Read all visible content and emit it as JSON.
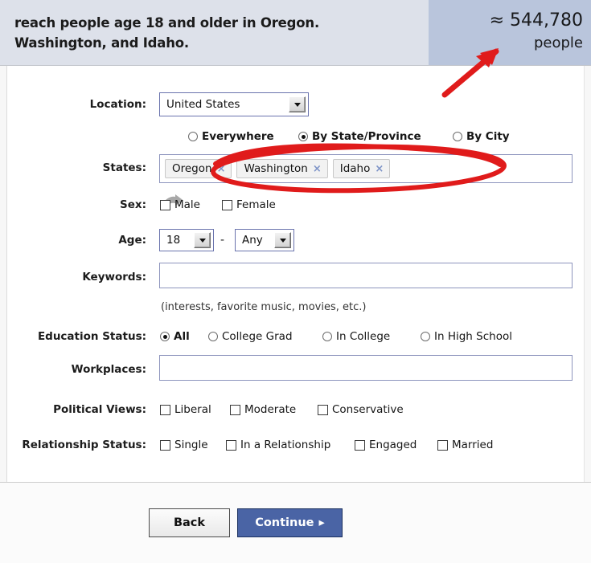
{
  "header": {
    "headline_line1": "reach people age 18 and older in Oregon.",
    "headline_line2": "Washington, and Idaho.",
    "reach_count": "≈ 544,780",
    "reach_label": "people"
  },
  "form": {
    "location": {
      "label": "Location:",
      "selected": "United States",
      "scope_options": [
        {
          "label": "Everywhere",
          "selected": false
        },
        {
          "label": "By State/Province",
          "selected": true
        },
        {
          "label": "By City",
          "selected": false
        }
      ]
    },
    "states": {
      "label": "States:",
      "tokens": [
        "Oregon",
        "Washington",
        "Idaho"
      ],
      "remove_glyph": "×"
    },
    "sex": {
      "label": "Sex:",
      "options": [
        {
          "label": "Male",
          "checked": false
        },
        {
          "label": "Female",
          "checked": false
        }
      ]
    },
    "age": {
      "label": "Age:",
      "min": "18",
      "separator": "-",
      "max": "Any"
    },
    "keywords": {
      "label": "Keywords:",
      "value": "",
      "placeholder": "",
      "hint": "(interests, favorite music, movies, etc.)"
    },
    "education": {
      "label": "Education Status:",
      "options": [
        {
          "label": "All",
          "selected": true
        },
        {
          "label": "College Grad",
          "selected": false
        },
        {
          "label": "In College",
          "selected": false
        },
        {
          "label": "In High School",
          "selected": false
        }
      ]
    },
    "workplaces": {
      "label": "Workplaces:",
      "value": "",
      "placeholder": ""
    },
    "political": {
      "label": "Political Views:",
      "options": [
        {
          "label": "Liberal",
          "checked": false
        },
        {
          "label": "Moderate",
          "checked": false
        },
        {
          "label": "Conservative",
          "checked": false
        }
      ]
    },
    "relationship": {
      "label": "Relationship Status:",
      "options": [
        {
          "label": "Single",
          "checked": false
        },
        {
          "label": "In a Relationship",
          "checked": false
        },
        {
          "label": "Engaged",
          "checked": false
        },
        {
          "label": "Married",
          "checked": false
        }
      ]
    }
  },
  "footer": {
    "back_label": "Back",
    "continue_label": "Continue",
    "continue_arrow": "▸"
  },
  "colors": {
    "header_left_bg": "#dde1ea",
    "header_right_bg": "#b9c5dc",
    "input_border": "#8d94bd",
    "continue_bg": "#4a64a5",
    "annotation_red": "#e01b1b",
    "token_x_blue": "#7d93c7"
  }
}
